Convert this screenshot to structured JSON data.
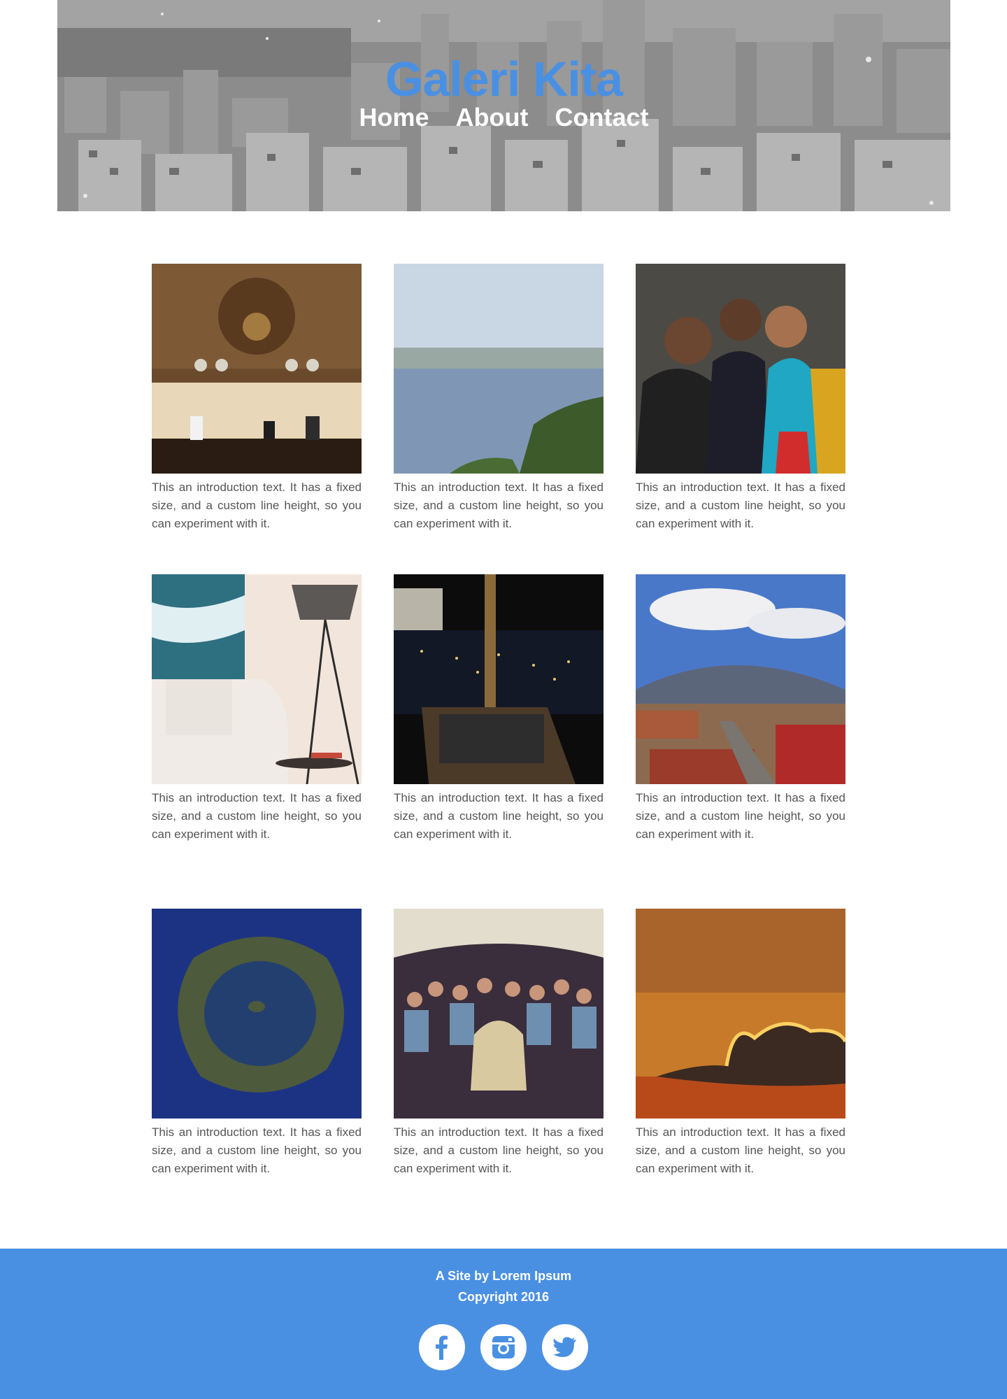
{
  "header": {
    "title": "Galeri Kita",
    "nav": [
      "Home",
      "About",
      "Contact"
    ]
  },
  "gallery": {
    "caption": "This an introduction text. It has a fixed size, and a custom line height, so you can experiment with it.",
    "items": [
      {
        "image": "hotel-lobby-reception"
      },
      {
        "image": "city-lake-view"
      },
      {
        "image": "three-people-smiling"
      },
      {
        "image": "living-room-sofa-lamp"
      },
      {
        "image": "night-city-chair"
      },
      {
        "image": "volcano-over-town"
      },
      {
        "image": "island-crater-satellite"
      },
      {
        "image": "group-under-tent"
      },
      {
        "image": "sunset-cloud"
      }
    ]
  },
  "footer": {
    "line1": "A Site by Lorem Ipsum",
    "line2": "Copyright 2016",
    "social": [
      "facebook-icon",
      "instagram-icon",
      "twitter-icon"
    ]
  },
  "colors": {
    "accent": "#4a90e2",
    "text": "#555555",
    "footer_text": "#ffffff"
  }
}
